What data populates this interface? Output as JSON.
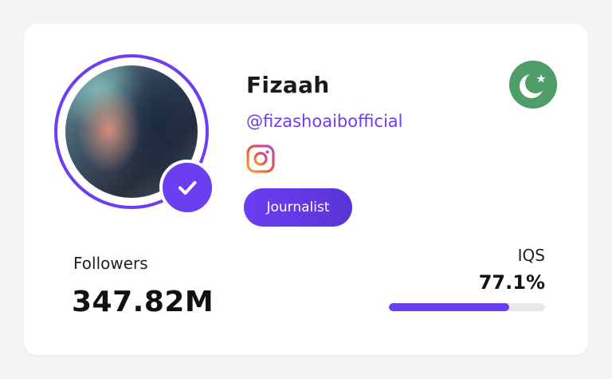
{
  "profile": {
    "name": "Fizaah",
    "handle": "@fizashoaibofficial",
    "platform_icon": "instagram-icon",
    "category": "Journalist",
    "verified_icon": "checkmark-icon",
    "country_flag_icon": "pakistan-flag-icon"
  },
  "stats": {
    "followers_label": "Followers",
    "followers_value": "347.82M",
    "iqs_label": "IQS",
    "iqs_value": "77.1%",
    "iqs_fraction": 0.771
  },
  "colors": {
    "accent": "#6b3ef2",
    "flag_green": "#4f9d69",
    "track": "#e8e8ec"
  }
}
